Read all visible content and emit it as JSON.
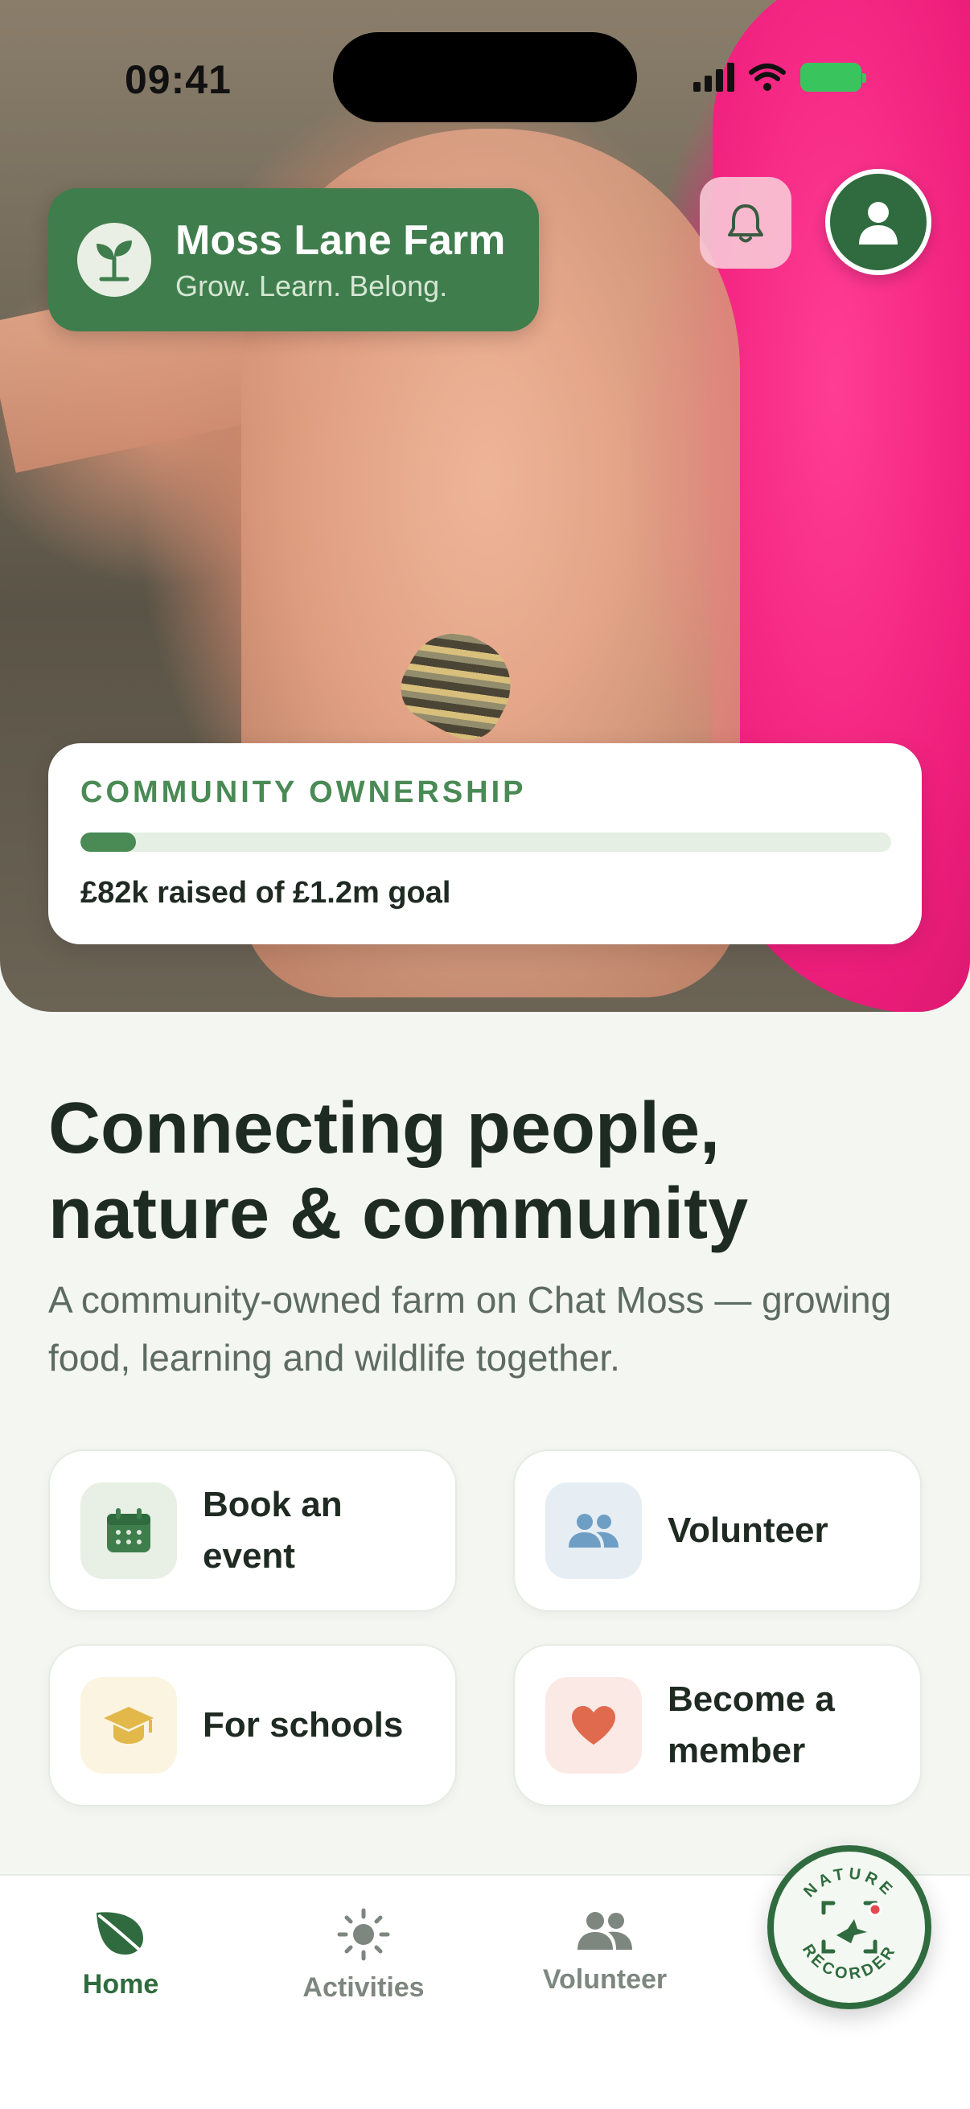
{
  "status_bar": {
    "time": "09:41"
  },
  "brand": {
    "name": "Moss Lane Farm",
    "tagline": "Grow. Learn. Belong."
  },
  "ownership": {
    "label": "COMMUNITY OWNERSHIP",
    "progress_percent": 6.8,
    "summary": "£82k raised of £1.2m goal"
  },
  "hero_text": {
    "headline_line1": "Connecting people,",
    "headline_line2": "nature & community",
    "subtext": "A community-owned farm on Chat Moss — growing food, learning and wildlife together."
  },
  "quick_actions": [
    {
      "label": "Book an\nevent",
      "icon": "calendar-icon",
      "bg": "#e8efe5",
      "color": "#3f7d4d"
    },
    {
      "label": "Volunteer",
      "icon": "people-icon",
      "bg": "#e6eef4",
      "color": "#6f9ec5"
    },
    {
      "label": "For schools",
      "icon": "graduation-cap-icon",
      "bg": "#fbf4e1",
      "color": "#e2b84a"
    },
    {
      "label": "Become a\nmember",
      "icon": "heart-icon",
      "bg": "#fbe9e6",
      "color": "#e06a4e"
    }
  ],
  "bottom_nav": [
    {
      "label": "Home",
      "icon": "leaf-icon",
      "active": true
    },
    {
      "label": "Activities",
      "icon": "sun-icon",
      "active": false
    },
    {
      "label": "Volunteer",
      "icon": "people-icon",
      "active": false
    }
  ],
  "nature_recorder": {
    "top_text": "NATURE",
    "bottom_text": "RECORDER"
  },
  "colors": {
    "primary": "#3f7d4d",
    "dark": "#2f6b3e",
    "accent_pink": "#f01f7d"
  }
}
